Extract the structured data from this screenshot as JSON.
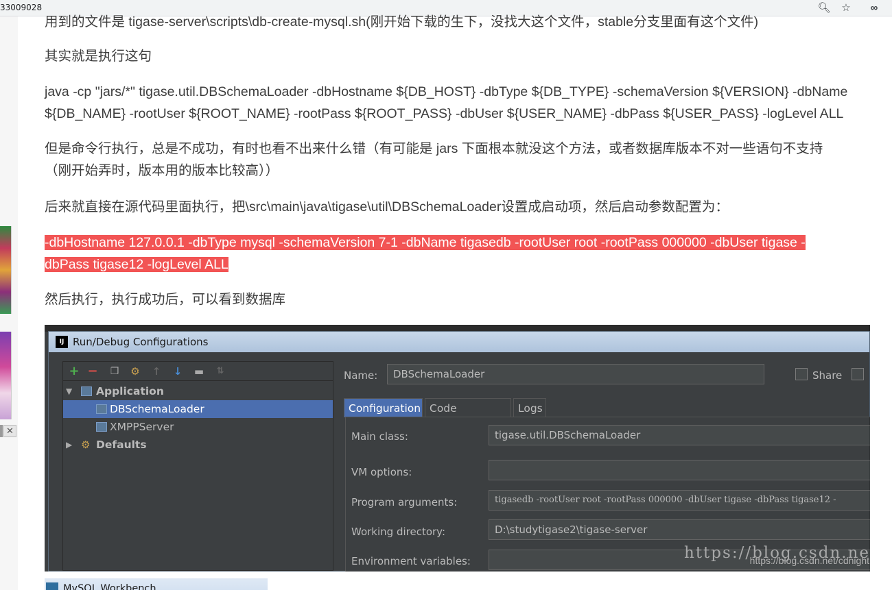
{
  "browser": {
    "url_fragment": "33009028",
    "icons": [
      "zoom-icon",
      "star-icon",
      "extension-icon"
    ]
  },
  "article": {
    "clipped_line": "用到的文件是 tigase-server\\scripts\\db-create-mysql.sh(刚开始下载的生下，没找大这个文件，stable分支里面有这个文件)",
    "p1": "其实就是执行这句",
    "p2_line1": "java -cp \"jars/*\" tigase.util.DBSchemaLoader -dbHostname ${DB_HOST} -dbType ${DB_TYPE} -schemaVersion ${VERSION} -dbName",
    "p2_line2": "${DB_NAME} -rootUser ${ROOT_NAME} -rootPass ${ROOT_PASS} -dbUser ${USER_NAME} -dbPass ${USER_PASS} -logLevel ALL",
    "p3_line1": "但是命令行执行，总是不成功，有时也看不出来什么错（有可能是 jars 下面根本就没这个方法，或者数据库版本不对一些语句不支持",
    "p3_line2": "（刚开始弄时，版本用的版本比较高））",
    "p4": "后来就直接在源代码里面执行，把\\src\\main\\java\\tigase\\util\\DBSchemaLoader设置成启动项，然后启动参数配置为：",
    "p5_line1": "-dbHostname 127.0.0.1 -dbType mysql -schemaVersion 7-1 -dbName tigasedb -rootUser root -rootPass 000000 -dbUser tigase -",
    "p5_line2": "dbPass tigase12 -logLevel ALL",
    "p6": "然后执行，执行成功后，可以看到数据库"
  },
  "dialog": {
    "app_icon": "IJ",
    "title": "Run/Debug Configurations",
    "toolbar": [
      "add-icon",
      "remove-icon",
      "copy-icon",
      "edit-defaults-icon",
      "move-up-icon",
      "move-down-icon",
      "folder-icon",
      "sort-icon"
    ],
    "tree": {
      "application": "Application",
      "item1": "DBSchemaLoader",
      "item2": "XMPPServer",
      "defaults": "Defaults"
    },
    "name_label": "Name:",
    "name_value": "DBSchemaLoader",
    "share_label": "Share",
    "tabs": [
      "Configuration",
      "Code Coverage",
      "Logs"
    ],
    "main_class_label": "Main class:",
    "main_class_value": "tigase.util.DBSchemaLoader",
    "vm_options_label": "VM options:",
    "vm_options_value": "",
    "program_args_label": "Program arguments:",
    "program_args_value": "tigasedb -rootUser root -rootPass 000000 -dbUser tigase -dbPass tigase12 -",
    "working_dir_label": "Working directory:",
    "working_dir_value": "D:\\studytigase2\\tigase-server",
    "env_vars_label": "Environment variables:",
    "env_vars_value": ""
  },
  "watermark": "https://blog.csdn.ne",
  "credit": "https://blog.csdn.net/cdnight",
  "next_shot": {
    "title": "MySQL Workbench"
  },
  "colors": {
    "highlight": "#f25454",
    "ide_bg": "#3c3f41",
    "ide_selection": "#4b6eaf"
  }
}
